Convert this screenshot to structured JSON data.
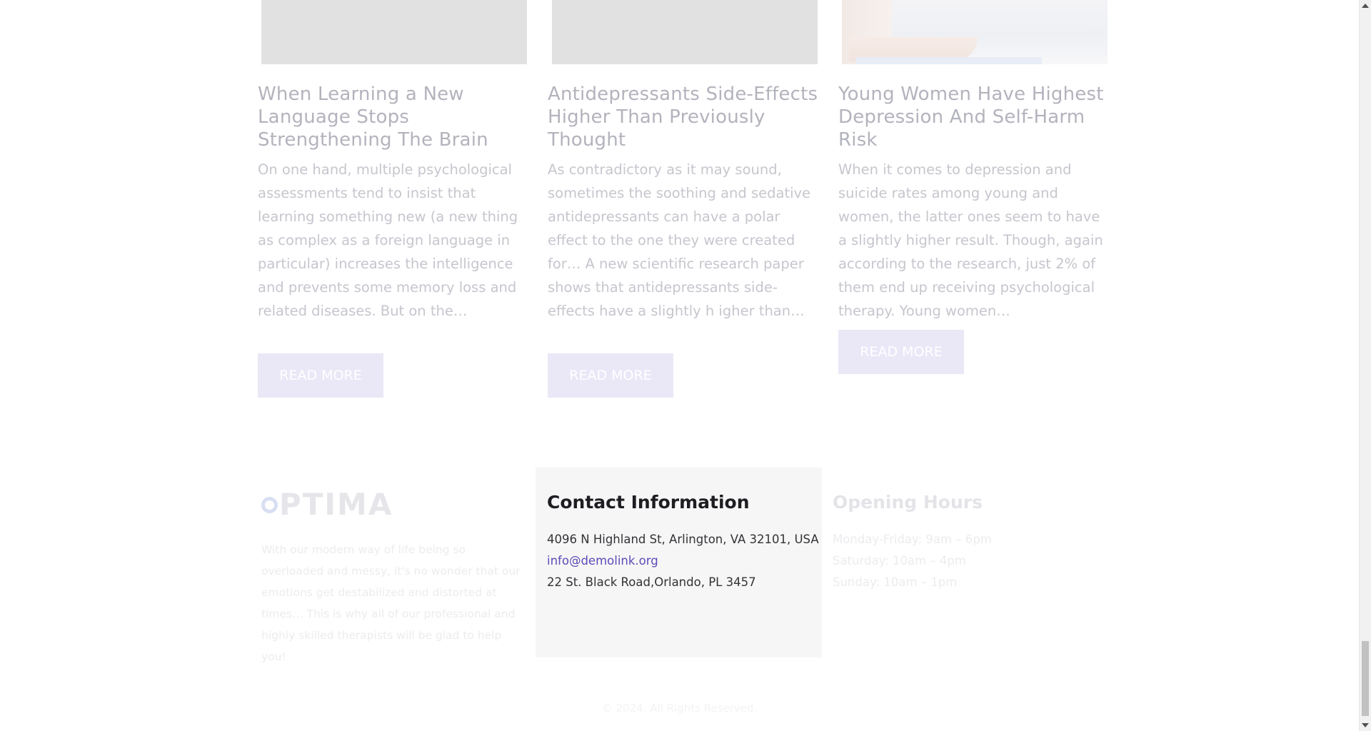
{
  "posts": [
    {
      "title": "When Learning a New Language Stops Strengthening The Brain",
      "excerpt": "    On one hand, multiple psychological assessments tend to insist that learning something new (a new thing as complex as a foreign language in particular) increases the intelligence and prevents some memory loss and related diseases. But on the…",
      "button": "READ MORE"
    },
    {
      "title": "Antidepressants Side-Effects Higher Than Previously Thought",
      "excerpt": "  As contradictory as it may sound, sometimes the soothing and sedative antidepressants can have a polar effect to the one they were created for… A new scientific research paper shows that antidepressants side-effects have a slightly h igher than…",
      "button": "READ MORE"
    },
    {
      "title": "Young Women Have Highest Depression And Self-Harm Risk",
      "excerpt": "  When it comes to depression and suicide rates among young  and women, the latter ones seem to have a slightly higher result. Though, again according to the research, just 2% of them end up receiving psychological therapy.  Young women…",
      "button": "READ MORE"
    }
  ],
  "footer": {
    "logo": "PTIMA",
    "about": "With our modern way of life being so overloaded and messy, it's no wonder that our emotions get destabilized and distorted at times… This is why all of our professional and highly skilled therapists will be glad to help you!",
    "contact": {
      "heading": "Contact Information",
      "address": "4096 N Highland St, Arlington, VA 32101, USA",
      "email": "info@demolink.org",
      "address2": "22 St. Black Road,Orlando, PL 3457"
    },
    "hours": {
      "heading": "Opening Hours",
      "weekdays": "Monday-Friday: 9am – 6pm",
      "saturday": "Saturday: 10am – 4pm",
      "sunday": "Sunday: 10am – 1pm"
    },
    "copyright": "© 2024. All Rights Reserved."
  },
  "colors": {
    "accent": "#5b4bb7",
    "button_bg": "#eae8f7"
  }
}
